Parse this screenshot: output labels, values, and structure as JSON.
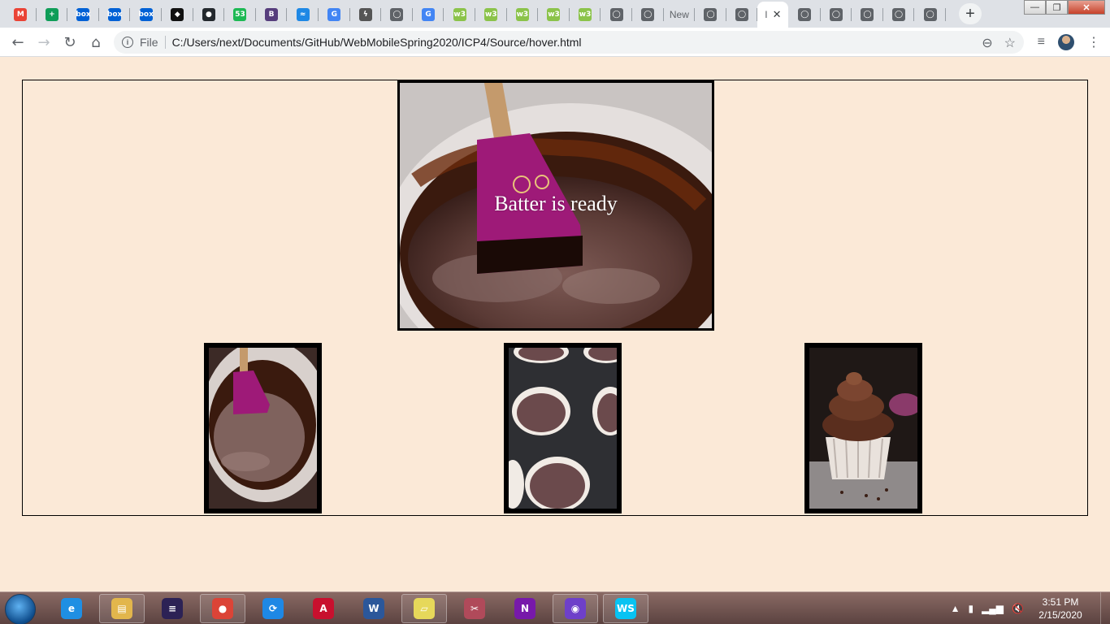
{
  "browser": {
    "tabs": [
      {
        "icon": "gmail-icon",
        "letter": "M",
        "color": "#ea4335"
      },
      {
        "icon": "sheets-icon",
        "letter": "+",
        "color": "#0f9d58"
      },
      {
        "icon": "box-icon",
        "letter": "box",
        "color": "#0061d5"
      },
      {
        "icon": "box-icon",
        "letter": "box",
        "color": "#0061d5"
      },
      {
        "icon": "box-icon",
        "letter": "box",
        "color": "#0061d5"
      },
      {
        "icon": "codepen-icon",
        "letter": "◆",
        "color": "#111111"
      },
      {
        "icon": "github-icon",
        "letter": "●",
        "color": "#24292e"
      },
      {
        "icon": "badge-53-icon",
        "letter": "53",
        "color": "#1db954"
      },
      {
        "icon": "bootstrap-icon",
        "letter": "B",
        "color": "#563d7c"
      },
      {
        "icon": "wave-icon",
        "letter": "≈",
        "color": "#1e88e5"
      },
      {
        "icon": "google-icon",
        "letter": "G",
        "color": "#4285f4"
      },
      {
        "icon": "stackblitz-icon",
        "letter": "ϟ",
        "color": "#555555"
      },
      {
        "icon": "globe-icon",
        "letter": "◯",
        "color": "#5f6368"
      },
      {
        "icon": "google-icon",
        "letter": "G",
        "color": "#4285f4"
      },
      {
        "icon": "w3schools-icon",
        "letter": "w3",
        "color": "#8bc34a"
      },
      {
        "icon": "w3schools-icon",
        "letter": "w3",
        "color": "#8bc34a"
      },
      {
        "icon": "w3schools-icon",
        "letter": "w3",
        "color": "#8bc34a"
      },
      {
        "icon": "w3schools-icon",
        "letter": "w3",
        "color": "#8bc34a"
      },
      {
        "icon": "w3schools-icon",
        "letter": "w3",
        "color": "#8bc34a"
      },
      {
        "icon": "globe-icon",
        "letter": "◯",
        "color": "#5f6368"
      },
      {
        "icon": "globe-icon",
        "letter": "◯",
        "color": "#5f6368"
      },
      {
        "icon": "new-tab-text",
        "letter": "New",
        "color": "#5f6368"
      },
      {
        "icon": "globe-icon",
        "letter": "◯",
        "color": "#5f6368"
      },
      {
        "icon": "globe-icon",
        "letter": "◯",
        "color": "#5f6368"
      },
      {
        "icon": "active-tab",
        "letter": "I",
        "color": "#5f6368"
      },
      {
        "icon": "globe-icon",
        "letter": "◯",
        "color": "#5f6368"
      },
      {
        "icon": "globe-icon",
        "letter": "◯",
        "color": "#5f6368"
      },
      {
        "icon": "globe-icon",
        "letter": "◯",
        "color": "#5f6368"
      },
      {
        "icon": "globe-icon",
        "letter": "◯",
        "color": "#5f6368"
      },
      {
        "icon": "globe-icon",
        "letter": "◯",
        "color": "#5f6368"
      }
    ],
    "new_tab_label": "+",
    "window_buttons": {
      "minimize": "—",
      "maximize": "❐",
      "close": "✕"
    },
    "nav": {
      "back": "←",
      "forward": "→",
      "reload": "↻",
      "home": "⌂"
    },
    "omnibox": {
      "info": "i",
      "scheme_label": "File",
      "url": "C:/Users/next/Documents/GitHub/WebMobileSpring2020/ICP4/Source/hover.html"
    },
    "omnibox_icons": {
      "zoom": "⊖",
      "bookmark": "☆"
    },
    "toolbar_icons": {
      "media": "≡",
      "menu": "⋮"
    }
  },
  "page": {
    "hero_caption": "Batter is ready",
    "thumbnails": [
      {
        "name": "batter-thumbnail"
      },
      {
        "name": "muffin-tin-thumbnail"
      },
      {
        "name": "cupcake-thumbnail"
      }
    ]
  },
  "taskbar": {
    "apps": [
      {
        "name": "internet-explorer-icon",
        "label": "e",
        "color": "#1f8fe3",
        "pinned": false
      },
      {
        "name": "file-explorer-icon",
        "label": "▤",
        "color": "#e2b64c",
        "pinned": true
      },
      {
        "name": "eclipse-icon",
        "label": "≡",
        "color": "#2c2255",
        "pinned": false
      },
      {
        "name": "chrome-icon",
        "label": "●",
        "color": "#db4437",
        "pinned": true
      },
      {
        "name": "sync-app-icon",
        "label": "⟳",
        "color": "#1e88e5",
        "pinned": false
      },
      {
        "name": "acrobat-icon",
        "label": "A",
        "color": "#c8102e",
        "pinned": false
      },
      {
        "name": "word-icon",
        "label": "W",
        "color": "#2b579a",
        "pinned": false
      },
      {
        "name": "sticky-notes-icon",
        "label": "▱",
        "color": "#e6d85a",
        "pinned": true
      },
      {
        "name": "snipping-tool-icon",
        "label": "✂",
        "color": "#b04a5a",
        "pinned": false
      },
      {
        "name": "onenote-icon",
        "label": "N",
        "color": "#7719aa",
        "pinned": false
      },
      {
        "name": "github-desktop-icon",
        "label": "◉",
        "color": "#6e40c9",
        "pinned": true
      },
      {
        "name": "webstorm-icon",
        "label": "WS",
        "color": "#07c3f2",
        "pinned": true
      }
    ],
    "tray": {
      "up_arrow": "▲",
      "device": "▮",
      "network": "▂▄▆",
      "volume": "🔇"
    },
    "clock": {
      "time": "3:51 PM",
      "date": "2/15/2020"
    }
  }
}
